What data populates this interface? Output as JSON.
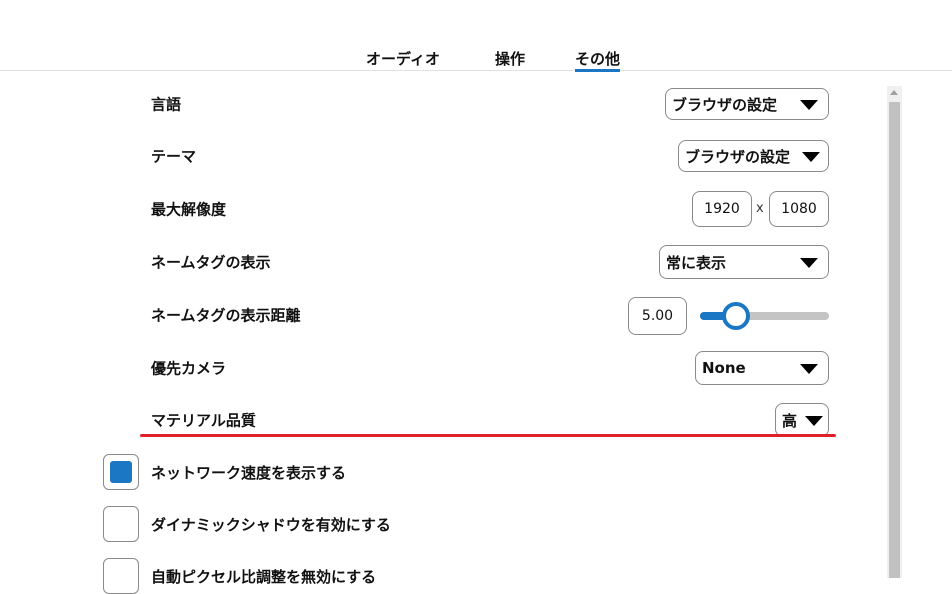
{
  "tabs": [
    {
      "label": "オーディオ",
      "active": false
    },
    {
      "label": "操作",
      "active": false
    },
    {
      "label": "その他",
      "active": true
    }
  ],
  "settings": {
    "language": {
      "label": "言語",
      "value": "ブラウザの設定"
    },
    "theme": {
      "label": "テーマ",
      "value": "ブラウザの設定"
    },
    "max_resolution": {
      "label": "最大解像度",
      "width": "1920",
      "separator": "x",
      "height": "1080"
    },
    "nametag_display": {
      "label": "ネームタグの表示",
      "value": "常に表示"
    },
    "nametag_distance": {
      "label": "ネームタグの表示距離",
      "value": "5.00",
      "slider_fraction": 0.28
    },
    "priority_camera": {
      "label": "優先カメラ",
      "value": "None"
    },
    "material_quality": {
      "label": "マテリアル品質",
      "value": "高"
    }
  },
  "checkboxes": [
    {
      "label": "ネットワーク速度を表示する",
      "checked": true
    },
    {
      "label": "ダイナミックシャドウを有効にする",
      "checked": false
    },
    {
      "label": "自動ピクセル比調整を無効にする",
      "checked": false
    }
  ],
  "colors": {
    "accent": "#1b76c4",
    "highlight_line": "#e0202a"
  }
}
